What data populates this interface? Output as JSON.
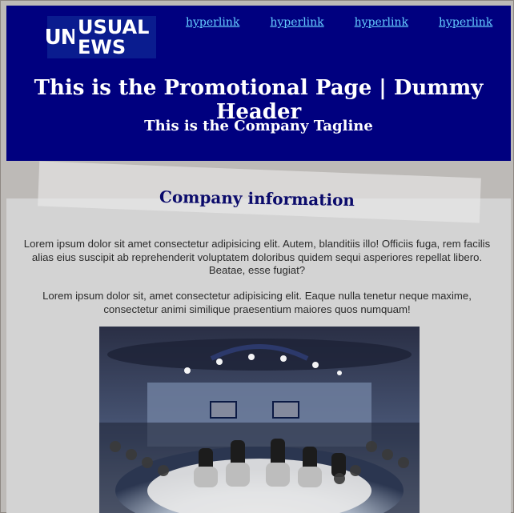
{
  "header": {
    "logo": {
      "mark": "UN",
      "line1": "USUAL",
      "line2": "EWS"
    },
    "nav": [
      "hyperlink",
      "hyperlink",
      "hyperlink",
      "hyperlink"
    ],
    "title": "This is the Promotional Page | Dummy Header",
    "tagline": "This is the Company Tagline"
  },
  "main": {
    "section_title": "Company information",
    "paragraphs": [
      "Lorem ipsum dolor sit amet consectetur adipisicing elit. Autem, blanditiis illo! Officiis fuga, rem facilis alias eius suscipit ab reprehenderit voluptatem doloribus quidem sequi asperiores repellat libero. Beatae, esse fugiat?",
      "Lorem ipsum dolor sit, amet consectetur adipisicing elit. Eaque nulla tenetur neque maxime, consectetur animi similique praesentium maiores quos numquam!"
    ]
  },
  "colors": {
    "header_bg": "#00007f",
    "link": "#66ccff",
    "section_title": "#0b0b6b"
  }
}
